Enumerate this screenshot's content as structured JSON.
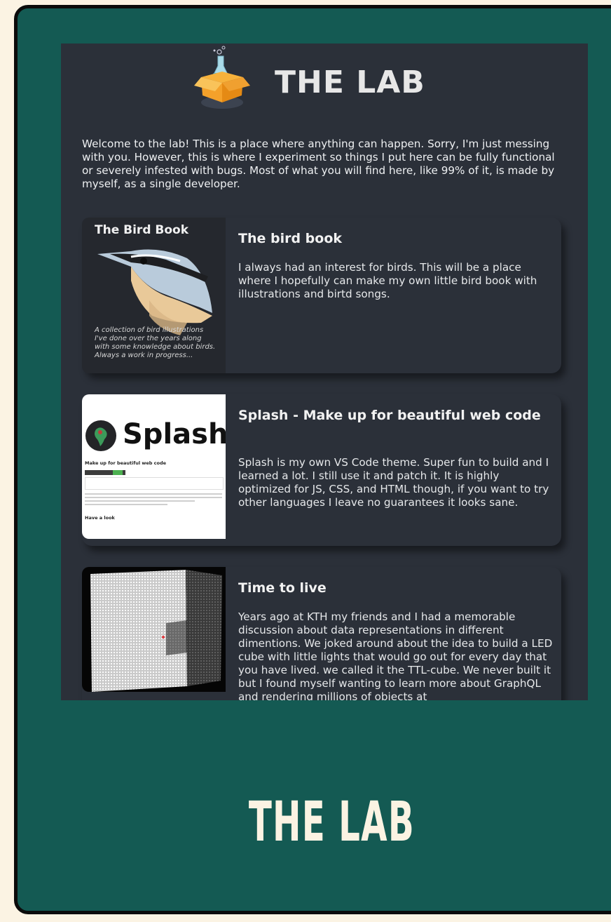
{
  "header": {
    "title": "THE LAB",
    "logo_icon": "lab-box-flask-icon"
  },
  "intro": "Welcome to the lab! This is a place where anything can happen. Sorry, I'm just messing with you. However, this is where I experiment so things I put here can be fully functional or severely infested with bugs. Most of what you will find here, like 99% of it, is made by myself, as a single developer.",
  "projects": [
    {
      "title": "The bird book",
      "description": "I always had an interest for birds. This will be a place where I hopefully can make my own little bird book with illustrations and birtd songs.",
      "thumb_title": "The Bird Book",
      "thumb_caption": "A collection of bird illustrations I've done over the years along with some knowledge about birds. Always a work in progress..."
    },
    {
      "title": "Splash - Make up for beautiful web code",
      "description": "Splash is my own VS Code theme. Super fun to build and I learned a lot. I still use it and patch it. It is highly optimized for JS, CSS, and HTML though, if you want to try other languages I leave no guarantees it looks sane.",
      "thumb_title": "Splash",
      "thumb_subtitle": "Make up for beautiful web code",
      "thumb_section": "Have a look"
    },
    {
      "title": "Time to live",
      "description": "Years ago at KTH my friends and I had a memorable discussion about data representations in different dimentions. We joked around about the idea to build a LED cube with little lights that would go out for every day that you have lived. we called it the TTL-cube. We never built it but I found myself wanting to learn more about GraphQL and rendering millions of objects at"
    }
  ],
  "footer": {
    "title": "THE LAB"
  },
  "colors": {
    "frame": "#145a53",
    "panel": "#2b3039",
    "cream": "#fbf3e3",
    "accent_orange": "#f4a12a"
  }
}
